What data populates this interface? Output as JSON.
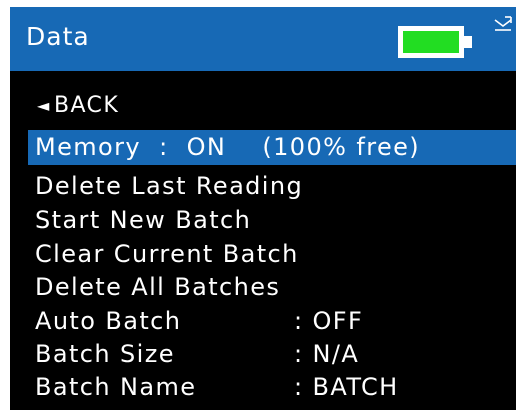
{
  "header": {
    "title": "Data",
    "battery_icon": "battery-icon",
    "battery_level": 1.0,
    "battery_color": "#22dd22",
    "status_icon": "mail-icon"
  },
  "colors": {
    "header_bg": "#1769b5",
    "screen_bg": "#000000",
    "text": "#ffffff",
    "highlight": "#1769b5"
  },
  "menu": {
    "back_arrow": "◄",
    "back_label": "BACK",
    "items": [
      {
        "label": "Memory  :  ON    (100% free)",
        "selected": true
      },
      {
        "label": "Delete Last Reading"
      },
      {
        "label": "Start New Batch"
      },
      {
        "label": "Clear Current Batch"
      },
      {
        "label": "Delete All Batches"
      },
      {
        "label": "Auto Batch",
        "value": ": OFF"
      },
      {
        "label": "Batch Size",
        "value": ": N/A"
      },
      {
        "label": "Batch Name",
        "value": ": BATCH"
      }
    ]
  }
}
